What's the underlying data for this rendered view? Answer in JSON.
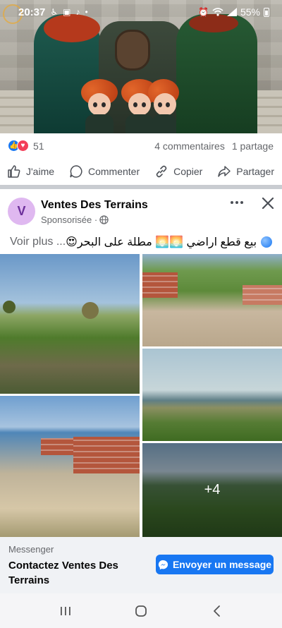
{
  "status_bar": {
    "time": "20:37",
    "battery": "55%",
    "icons": [
      "accessibility-icon",
      "gallery-icon",
      "tiktok-icon",
      "dot-icon",
      "alarm-icon",
      "wifi-icon",
      "signal-icon",
      "battery-icon"
    ]
  },
  "previous_post": {
    "photo": "animated-movie-still-icon",
    "reaction_count": "51",
    "comments": "4 commentaires",
    "shares": "1 partage",
    "actions": {
      "like": "J'aime",
      "comment": "Commenter",
      "copy": "Copier",
      "share": "Partager"
    }
  },
  "ad_post": {
    "avatar_letter": "V",
    "page_name": "Ventes Des Terrains",
    "sponsored_label": "Sponsorisée ·",
    "text": "بيع قطع اراضي 🌅🌅 مطلة على البحر😍",
    "see_more": "Voir plus ...",
    "extra_photos": "+4",
    "cta_source": "Messenger",
    "cta_title": "Contactez Ventes Des Terrains",
    "cta_button": "Envoyer un message"
  },
  "colors": {
    "facebook_blue": "#1877f2",
    "love_red": "#f33e58",
    "avatar_bg": "#dfb8f0",
    "text_secondary": "#65676b"
  }
}
